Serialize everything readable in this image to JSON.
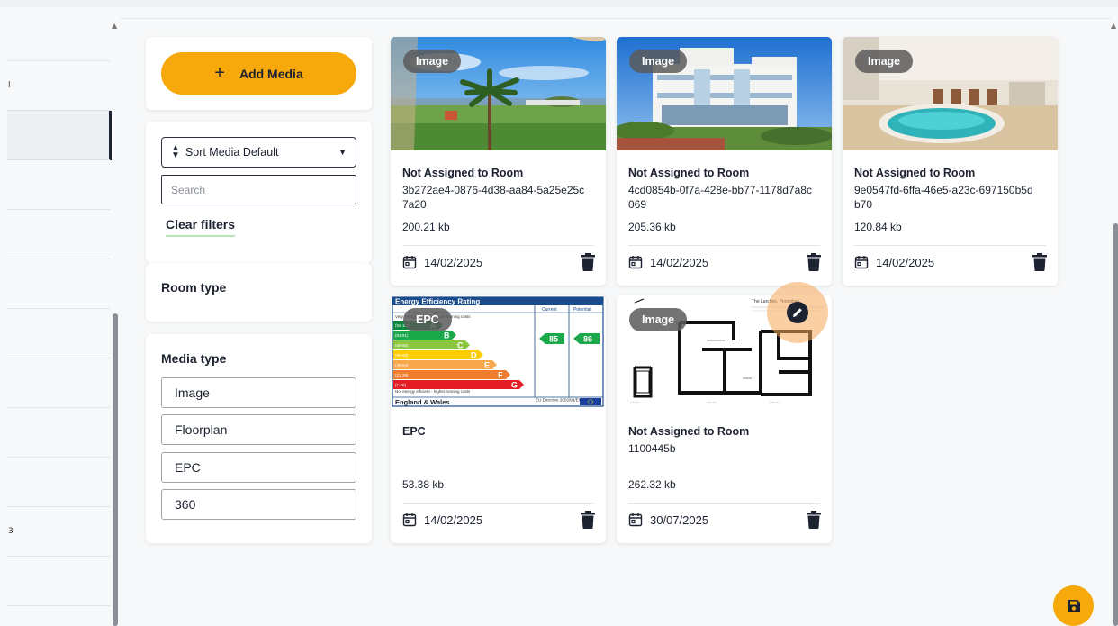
{
  "sidebar": {
    "glyphs": [
      "l",
      "3"
    ]
  },
  "actions": {
    "add_media": "Add Media",
    "add_icon": "+"
  },
  "filters": {
    "sort_value": "Sort Media Default",
    "search_placeholder": "Search",
    "clear_label": "Clear filters",
    "room_type_label": "Room type",
    "media_type_label": "Media type",
    "media_types": [
      "Image",
      "Floorplan",
      "EPC",
      "360"
    ]
  },
  "cards": [
    {
      "badge": "Image",
      "room": "Not Assigned to Room",
      "id": "3b272ae4-0876-4d38-aa84-5a25e25c7a20",
      "size": "200.21 kb",
      "date": "14/02/2025"
    },
    {
      "badge": "Image",
      "room": "Not Assigned to Room",
      "id": "4cd0854b-0f7a-428e-bb77-1178d7a8c069",
      "size": "205.36 kb",
      "date": "14/02/2025"
    },
    {
      "badge": "Image",
      "room": "Not Assigned to Room",
      "id": "9e0547fd-6ffa-46e5-a23c-697150b5db70",
      "size": "120.84 kb",
      "date": "14/02/2025"
    },
    {
      "badge": "EPC",
      "room": "EPC",
      "id": "",
      "size": "53.38 kb",
      "date": "14/02/2025"
    },
    {
      "badge": "Image",
      "room": "Not Assigned to Room",
      "id": "1100445b",
      "size": "262.32 kb",
      "date": "30/07/2025"
    }
  ],
  "epc": {
    "title": "Energy Efficiency Rating",
    "col_current": "Current",
    "col_potential": "Potential",
    "top_note": "Very energy efficient - lower running costs",
    "bottom_note": "Not energy efficient - higher running costs",
    "bands": [
      {
        "range": "(92-100)",
        "letter": "A",
        "color": "#0a8a3a"
      },
      {
        "range": "(81-91)",
        "letter": "B",
        "color": "#1aa84a"
      },
      {
        "range": "(69-80)",
        "letter": "C",
        "color": "#8cc63f"
      },
      {
        "range": "(55-68)",
        "letter": "D",
        "color": "#ffcc00"
      },
      {
        "range": "(39-54)",
        "letter": "E",
        "color": "#f7a84a"
      },
      {
        "range": "(21-38)",
        "letter": "F",
        "color": "#ef7d2d"
      },
      {
        "range": "(1-20)",
        "letter": "G",
        "color": "#e31d23"
      }
    ],
    "current": "85",
    "potential": "86",
    "footer": "England & Wales",
    "directive": "EU Directive 2002/91/EC"
  },
  "floorplan": {
    "title": "The Larches, Penterlow"
  },
  "colors": {
    "accent": "#f7a80a",
    "text": "#1c2230"
  }
}
